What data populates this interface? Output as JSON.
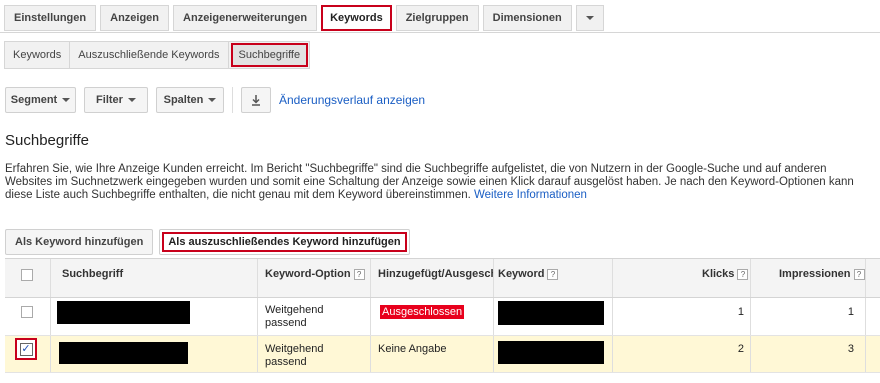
{
  "tabs": [
    {
      "label": "Einstellungen",
      "active": false
    },
    {
      "label": "Anzeigen",
      "active": false
    },
    {
      "label": "Anzeigenerweiterungen",
      "active": false
    },
    {
      "label": "Keywords",
      "active": true
    },
    {
      "label": "Zielgruppen",
      "active": false
    },
    {
      "label": "Dimensionen",
      "active": false
    }
  ],
  "subtabs": [
    {
      "label": "Keywords",
      "active": false
    },
    {
      "label": "Auszuschließende Keywords",
      "active": false
    },
    {
      "label": "Suchbegriffe",
      "active": true
    }
  ],
  "toolbar": {
    "segment_label": "Segment",
    "filter_label": "Filter",
    "spalten_label": "Spalten",
    "download_icon": "download-icon",
    "history_link": "Änderungsverlauf anzeigen"
  },
  "page": {
    "title": "Suchbegriffe",
    "description": "Erfahren Sie, wie Ihre Anzeige Kunden erreicht. Im Bericht \"Suchbegriffe\" sind die Suchbegriffe aufgelistet, die von Nutzern in der Google-Suche und auf anderen Websites im Suchnetzwerk eingegeben wurden und somit eine Schaltung der Anzeige sowie einen Klick darauf ausgelöst haben. Je nach den Keyword-Optionen kann diese Liste auch Suchbegriffe enthalten, die nicht genau mit dem Keyword übereinstimmen.",
    "more_link": "Weitere Informationen"
  },
  "actions": {
    "add_keyword": "Als Keyword hinzufügen",
    "add_negative": "Als auszuschließendes Keyword hinzufügen"
  },
  "table": {
    "headers": {
      "search_term": "Suchbegriff",
      "keyword_option": "Keyword-Option",
      "added_excluded": "Hinzugefügt/Ausgeschlossen",
      "keyword": "Keyword",
      "clicks": "Klicks",
      "impressions": "Impressionen"
    },
    "rows": [
      {
        "checked": false,
        "option_line1": "Weitgehend",
        "option_line2": "passend",
        "status": "Ausgeschlossen",
        "status_badge": true,
        "clicks": "1",
        "impressions": "1"
      },
      {
        "checked": true,
        "option_line1": "Weitgehend",
        "option_line2": "passend",
        "status": "Keine Angabe",
        "status_badge": false,
        "clicks": "2",
        "impressions": "3"
      }
    ]
  },
  "colors": {
    "highlight_red": "#c8001b",
    "badge_red": "#e8001c",
    "link_blue": "#1a5ec4",
    "selected_row": "#fff8d6"
  }
}
